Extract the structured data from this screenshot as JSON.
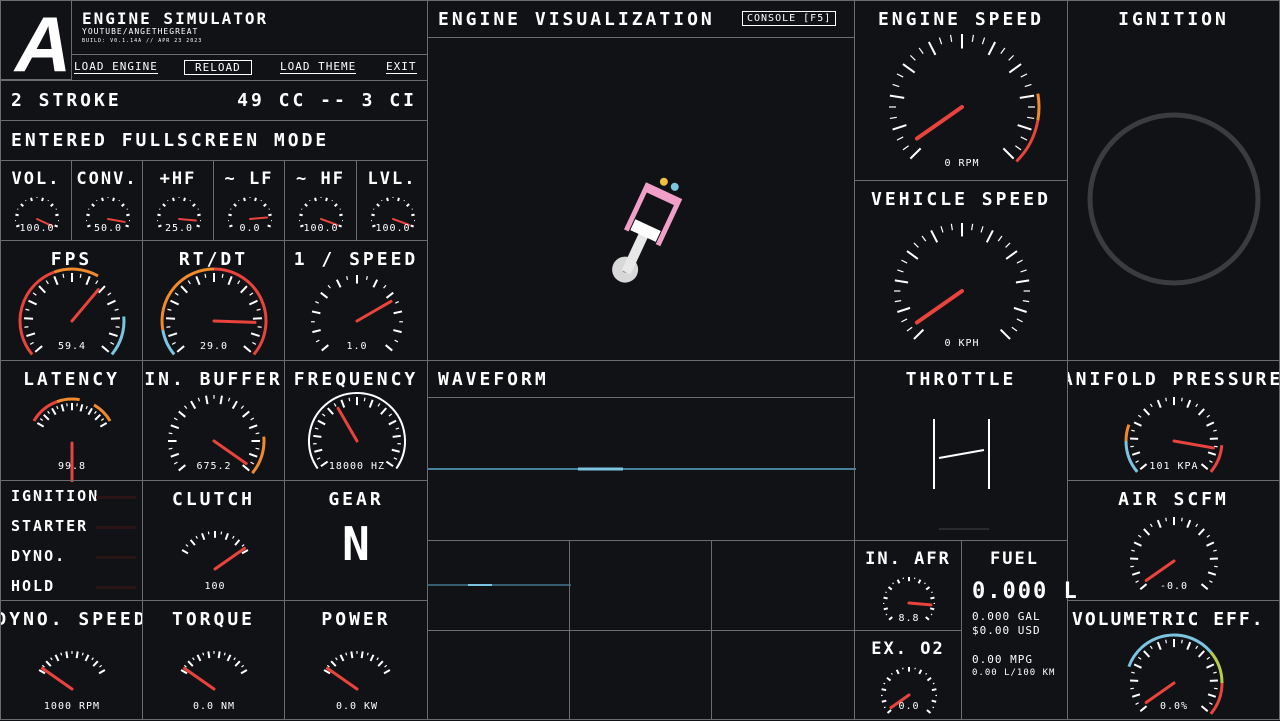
{
  "app": {
    "logo": "A",
    "title": "ENGINE SIMULATOR",
    "author": "YOUTUBE/ANGETHEGREAT",
    "build": "BUILD: V0.1.14A // APR 23 2023"
  },
  "menu": {
    "load_engine": "LOAD ENGINE",
    "reload": "RELOAD",
    "load_theme": "LOAD THEME",
    "exit": "EXIT"
  },
  "engine_info": {
    "type": "2 STROKE",
    "displacement": "49 CC -- 3 CI"
  },
  "status_message": "ENTERED FULLSCREEN MODE",
  "audio_knobs": [
    {
      "label": "VOL.",
      "value": "100.0"
    },
    {
      "label": "CONV.",
      "value": "50.0"
    },
    {
      "label": "+HF",
      "value": "25.0"
    },
    {
      "label": "~ LF",
      "value": "0.0"
    },
    {
      "label": "~ HF",
      "value": "100.0"
    },
    {
      "label": "LVL.",
      "value": "100.0"
    }
  ],
  "perf": {
    "fps": {
      "label": "FPS",
      "value": "59.4"
    },
    "rtdt": {
      "label": "RT/DT",
      "value": "29.0"
    },
    "speed": {
      "label": "1 / SPEED",
      "value": "1.0"
    },
    "latency": {
      "label": "LATENCY",
      "value": "99.8"
    },
    "in_buffer": {
      "label": "IN. BUFFER",
      "value": "675.2"
    },
    "frequency": {
      "label": "FREQUENCY",
      "value": "18000 HZ"
    }
  },
  "indicators": [
    "IGNITION",
    "STARTER",
    "DYNO.",
    "HOLD"
  ],
  "clutch": {
    "label": "CLUTCH",
    "value": "100"
  },
  "gear": {
    "label": "GEAR",
    "value": "N"
  },
  "dyno_speed": {
    "label": "DYNO. SPEED",
    "value": "1000 RPM"
  },
  "torque": {
    "label": "TORQUE",
    "value": "0.0 NM"
  },
  "power": {
    "label": "POWER",
    "value": "0.0 KW"
  },
  "visualization": {
    "label": "ENGINE VISUALIZATION",
    "console_button": "CONSOLE [F5]"
  },
  "waveform": {
    "label": "WAVEFORM"
  },
  "engine_speed": {
    "label": "ENGINE SPEED",
    "value": "0 RPM"
  },
  "vehicle_speed": {
    "label": "VEHICLE SPEED",
    "value": "0 KPH"
  },
  "ignition_panel": {
    "label": "IGNITION"
  },
  "throttle": {
    "label": "THROTTLE"
  },
  "manifold": {
    "label": "MANIFOLD PRESSURE",
    "value": "101 KPA"
  },
  "air_scfm": {
    "label": "AIR SCFM",
    "value": "-0.0"
  },
  "in_afr": {
    "label": "IN. AFR",
    "value": "8.8"
  },
  "ex_o2": {
    "label": "EX. O2",
    "value": "0.0"
  },
  "fuel": {
    "label": "FUEL",
    "liters": "0.000 L",
    "gal": "0.000 GAL",
    "usd": "$0.00 USD",
    "mpg": "0.00 MPG",
    "l100": "0.00 L/100 KM"
  },
  "volumetric": {
    "label": "VOLUMETRIC EFF.",
    "value": "0.0%"
  },
  "colors": {
    "bg": "#111216",
    "grid": "#6a6c70",
    "needle": "#e8433d",
    "orange": "#f08a2c",
    "blue": "#7cc4e0",
    "green": "#b9cc4a"
  }
}
